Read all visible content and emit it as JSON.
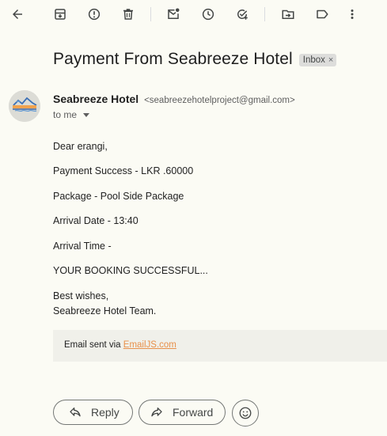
{
  "toolbar": {
    "icons": [
      "back-arrow-icon",
      "archive-icon",
      "report-spam-icon",
      "delete-icon",
      "mark-unread-icon",
      "snooze-icon",
      "add-task-icon",
      "move-to-icon",
      "label-icon",
      "more-icon"
    ]
  },
  "email": {
    "subject": "Payment From Seabreeze Hotel",
    "label": "Inbox",
    "label_close": "×",
    "sender_name": "Seabreeze Hotel",
    "sender_email": "<seabreezehotelproject@gmail.com>",
    "recipient": "to me",
    "body": {
      "greeting": "Dear erangi,",
      "payment": "Payment Success - LKR .60000",
      "package": "Package - Pool Side Package",
      "arrival_date": "Arrival Date - 13:40",
      "arrival_time": "Arrival Time -",
      "status": "YOUR BOOKING SUCCESSFUL...",
      "closing": "Best wishes,",
      "signature": "Seabreeze Hotel Team."
    },
    "footer": {
      "text": "Email sent via ",
      "link": "EmailJS.com"
    }
  },
  "actions": {
    "reply": "Reply",
    "forward": "Forward"
  },
  "colors": {
    "background": "#fbfbf4",
    "link": "#e8904a",
    "icon": "#444746"
  }
}
